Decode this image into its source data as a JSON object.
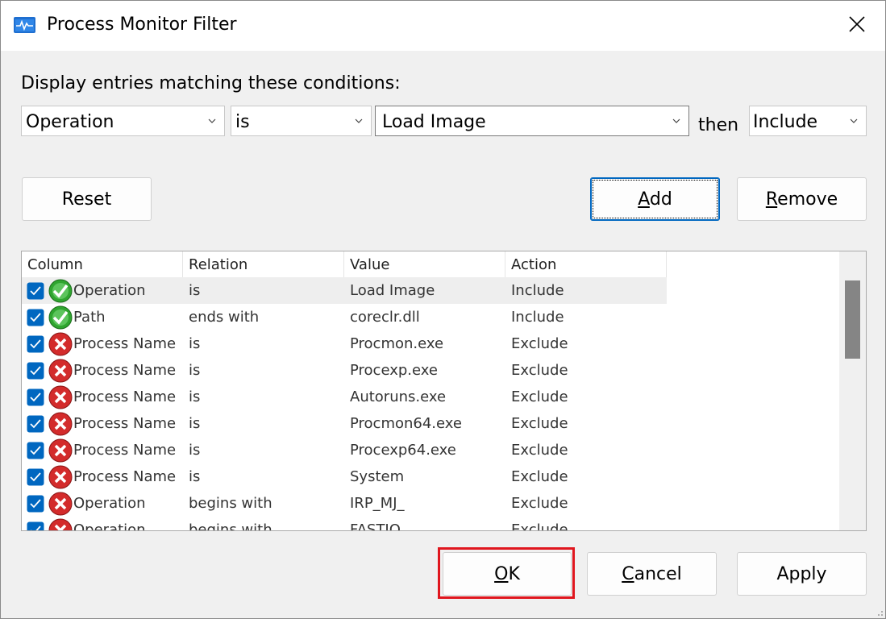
{
  "window": {
    "title": "Process Monitor Filter"
  },
  "prompt": "Display entries matching these conditions:",
  "condition": {
    "column": "Operation",
    "relation": "is",
    "value": "Load Image",
    "then_label": "then",
    "action": "Include"
  },
  "buttons": {
    "reset": "Reset",
    "add_a": "A",
    "add_b": "dd",
    "remove_a": "R",
    "remove_b": "emove",
    "ok_a": "O",
    "ok_b": "K",
    "cancel_a": "C",
    "cancel_b": "ancel",
    "apply": "Apply"
  },
  "table": {
    "headers": [
      "Column",
      "Relation",
      "Value",
      "Action"
    ],
    "rows": [
      {
        "column": "Operation",
        "relation": "is",
        "value": "Load Image",
        "action": "Include",
        "status": "include"
      },
      {
        "column": "Path",
        "relation": "ends with",
        "value": "coreclr.dll",
        "action": "Include",
        "status": "include"
      },
      {
        "column": "Process Name",
        "relation": "is",
        "value": "Procmon.exe",
        "action": "Exclude",
        "status": "exclude"
      },
      {
        "column": "Process Name",
        "relation": "is",
        "value": "Procexp.exe",
        "action": "Exclude",
        "status": "exclude"
      },
      {
        "column": "Process Name",
        "relation": "is",
        "value": "Autoruns.exe",
        "action": "Exclude",
        "status": "exclude"
      },
      {
        "column": "Process Name",
        "relation": "is",
        "value": "Procmon64.exe",
        "action": "Exclude",
        "status": "exclude"
      },
      {
        "column": "Process Name",
        "relation": "is",
        "value": "Procexp64.exe",
        "action": "Exclude",
        "status": "exclude"
      },
      {
        "column": "Process Name",
        "relation": "is",
        "value": "System",
        "action": "Exclude",
        "status": "exclude"
      },
      {
        "column": "Operation",
        "relation": "begins with",
        "value": "IRP_MJ_",
        "action": "Exclude",
        "status": "exclude"
      },
      {
        "column": "Operation",
        "relation": "begins with",
        "value": "FASTIO_",
        "action": "Exclude",
        "status": "exclude"
      }
    ]
  },
  "colors": {
    "accent": "#0067c0",
    "highlight": "#e0161e",
    "include": "#2fa52f",
    "exclude": "#d32b2b"
  }
}
